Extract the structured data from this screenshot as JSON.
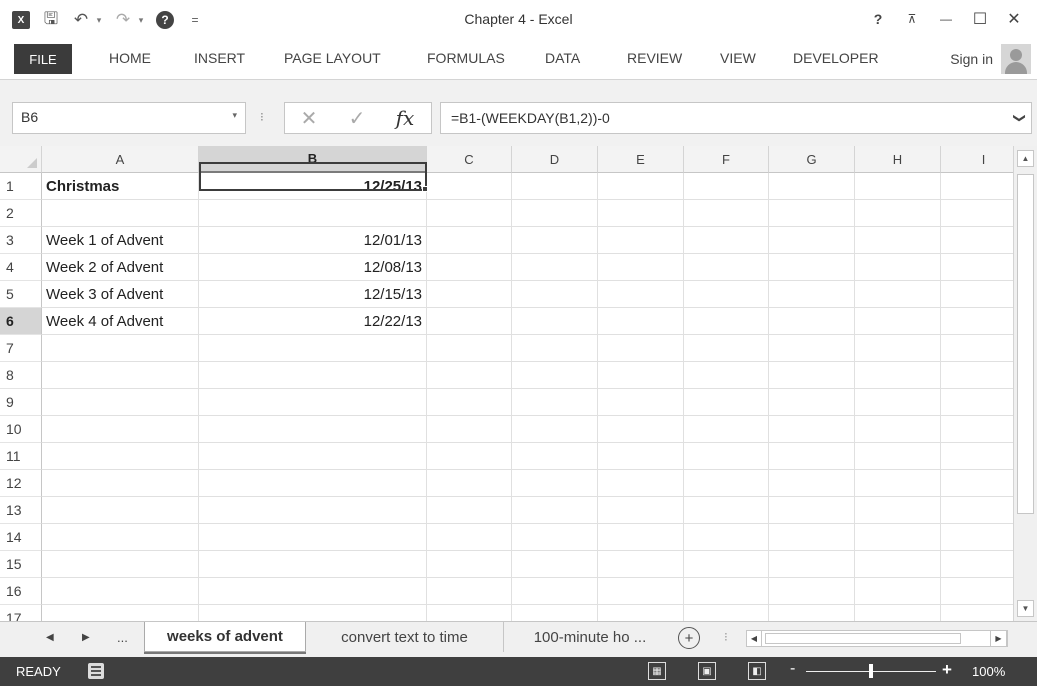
{
  "window": {
    "title": "Chapter 4 - Excel",
    "help_label": "?",
    "ribbon_display_label": "⊼",
    "minimize_label": "—",
    "maximize_label": "☐",
    "close_label": "✕"
  },
  "qat": {
    "app_logo": "X",
    "save_icon": "🖫",
    "undo_icon": "↶",
    "redo_icon": "↷",
    "dropdown": "▾",
    "help_icon": "?",
    "customize": "="
  },
  "ribbon": {
    "tabs": [
      "FILE",
      "HOME",
      "INSERT",
      "PAGE LAYOUT",
      "FORMULAS",
      "DATA",
      "REVIEW",
      "VIEW",
      "DEVELOPER"
    ],
    "sign_in": "Sign in"
  },
  "formula_bar": {
    "name_box": "B6",
    "name_dropdown": "▾",
    "separator": "⁝",
    "cancel_icon": "✕",
    "enter_icon": "✓",
    "fx_label": "fx",
    "formula": "=B1-(WEEKDAY(B1,2))-0",
    "expand_icon": "❯"
  },
  "grid": {
    "columns": [
      "A",
      "B",
      "C",
      "D",
      "E",
      "F",
      "G",
      "H",
      "I"
    ],
    "selected_column": "B",
    "rows": [
      "1",
      "2",
      "3",
      "4",
      "5",
      "6",
      "7",
      "8",
      "9",
      "10",
      "11",
      "12",
      "13",
      "14",
      "15",
      "16",
      "17"
    ],
    "selected_row": "6",
    "cells": {
      "A1": "Christmas",
      "B1": "12/25/13",
      "A3": "Week 1 of Advent",
      "B3": "12/01/13",
      "A4": "Week 2 of Advent",
      "B4": "12/08/13",
      "A5": "Week 3 of Advent",
      "B5": "12/15/13",
      "A6": "Week 4 of Advent",
      "B6": "12/22/13"
    },
    "active_cell": "B6"
  },
  "scrollbar": {
    "up": "▲",
    "down": "▼",
    "left": "◀",
    "right": "▶"
  },
  "sheets": {
    "nav_prev": "◀",
    "nav_next": "▶",
    "nav_more": "...",
    "tabs": [
      "weeks of advent",
      "convert text to time",
      "100-minute ho ..."
    ],
    "active": "weeks of advent",
    "add_icon": "+",
    "separator": "⁝"
  },
  "status": {
    "ready": "READY",
    "view_normal": "▦",
    "view_page_layout": "▣",
    "view_page_break": "◧",
    "zoom_minus": "-",
    "zoom_plus": "+",
    "zoom": "100%",
    "zoom_fraction": 0.5
  }
}
